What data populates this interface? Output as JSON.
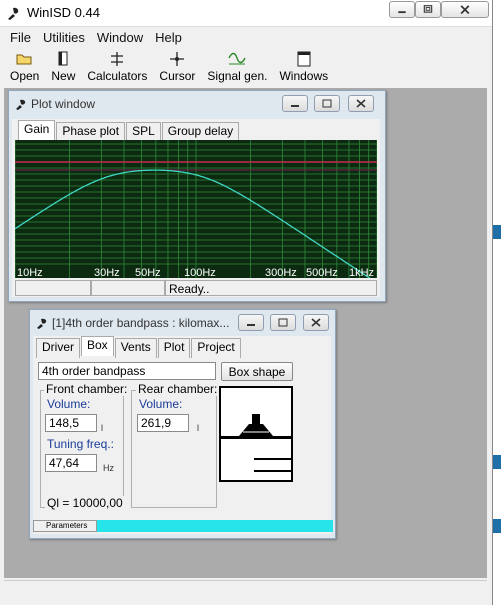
{
  "app": {
    "title": "WinISD 0.44"
  },
  "menu": [
    "File",
    "Utilities",
    "Window",
    "Help"
  ],
  "toolbar": [
    "Open",
    "New",
    "Calculators",
    "Cursor",
    "Signal gen.",
    "Windows"
  ],
  "plot_window": {
    "title": "Plot window",
    "tabs": [
      "Gain",
      "Phase plot",
      "SPL",
      "Group delay"
    ],
    "active_tab": "Gain",
    "status": "Ready..",
    "freq_labels": [
      "10Hz",
      "30Hz",
      "50Hz",
      "100Hz",
      "300Hz",
      "500Hz",
      "1kHz"
    ]
  },
  "project_window": {
    "title": "[1]4th order bandpass : kilomax...",
    "tabs": [
      "Driver",
      "Box",
      "Vents",
      "Plot",
      "Project"
    ],
    "active_tab": "Box",
    "box_type": "4th order bandpass",
    "box_shape_button": "Box shape",
    "front_chamber": {
      "label": "Front chamber:",
      "volume_label": "Volume:",
      "volume": "148,5",
      "volume_unit": "l",
      "tuning_label": "Tuning freq.:",
      "tuning": "47,64",
      "tuning_unit": "Hz"
    },
    "rear_chamber": {
      "label": "Rear chamber:",
      "volume_label": "Volume:",
      "volume": "261,9",
      "volume_unit": "l"
    },
    "ql": "Ql = 10000,00",
    "bottom_tab": "Parameters"
  },
  "colors": {
    "plot_bg": "#0b2a10",
    "grid": "#2f8a3a",
    "curve": "#3fd7c4",
    "ref_line": "#c22a4a",
    "progress": "#27e3ea"
  }
}
